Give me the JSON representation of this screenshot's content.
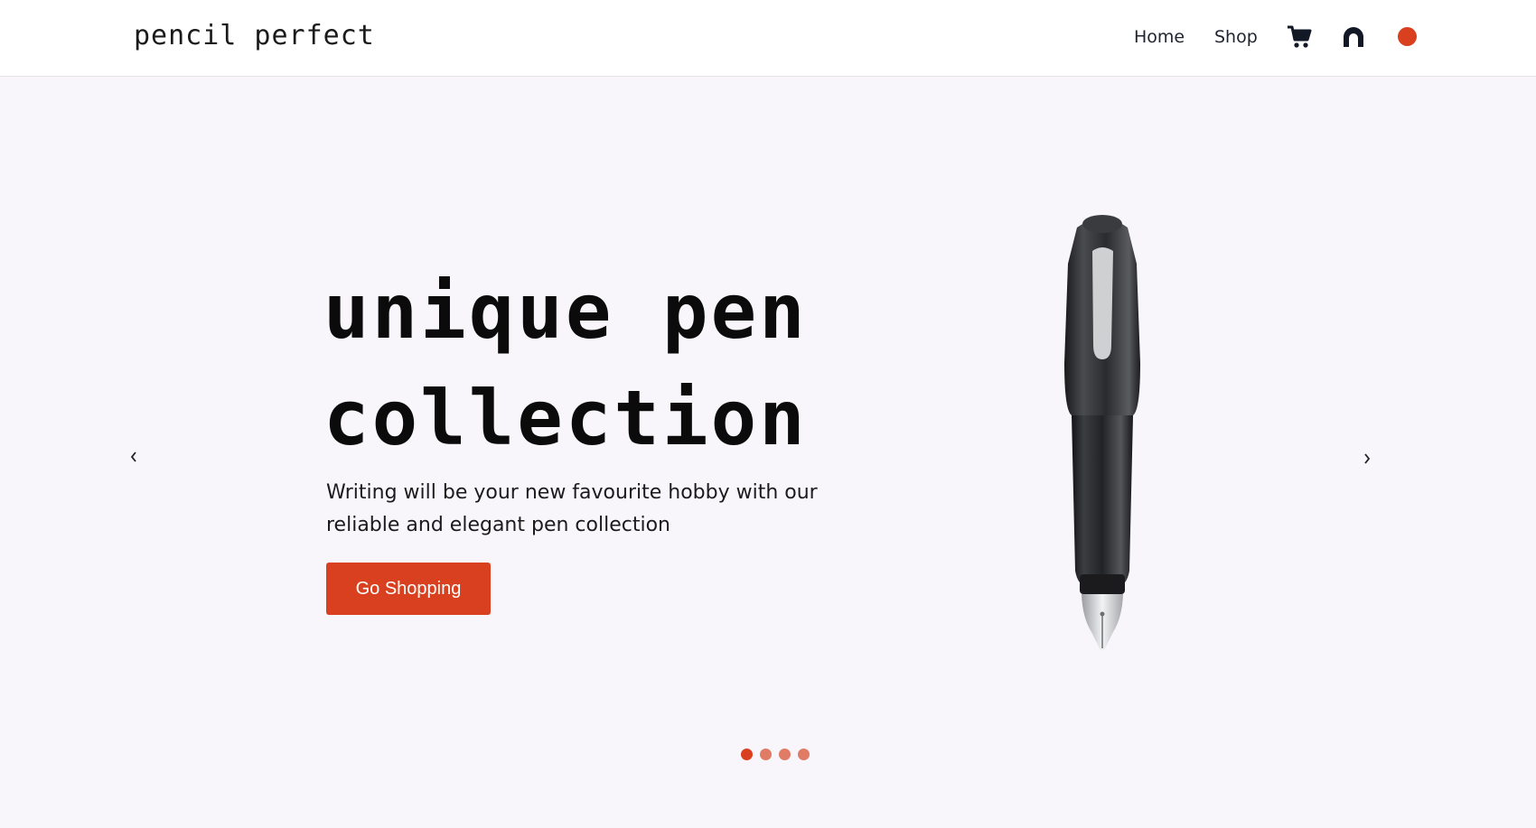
{
  "header": {
    "logo": "pencil perfect",
    "nav": [
      {
        "label": "Home"
      },
      {
        "label": "Shop"
      }
    ],
    "icons": {
      "cart": "cart-icon",
      "user": "user-icon",
      "theme": "theme-toggle"
    }
  },
  "hero": {
    "title_line1": "unique pen",
    "title_line2": "collection",
    "subtitle": "Writing will be your new favourite hobby with our reliable and elegant pen collection",
    "cta_label": "Go Shopping",
    "prev_arrow": "‹",
    "next_arrow": "›",
    "image": "fountain-pen-illustration"
  },
  "carousel": {
    "slides": 4,
    "active_index": 0
  },
  "colors": {
    "accent": "#d9401f",
    "dot_inactive": "#e07b66",
    "background": "#f8f6fb",
    "header_bg": "#ffffff",
    "text_dark": "#111111"
  }
}
